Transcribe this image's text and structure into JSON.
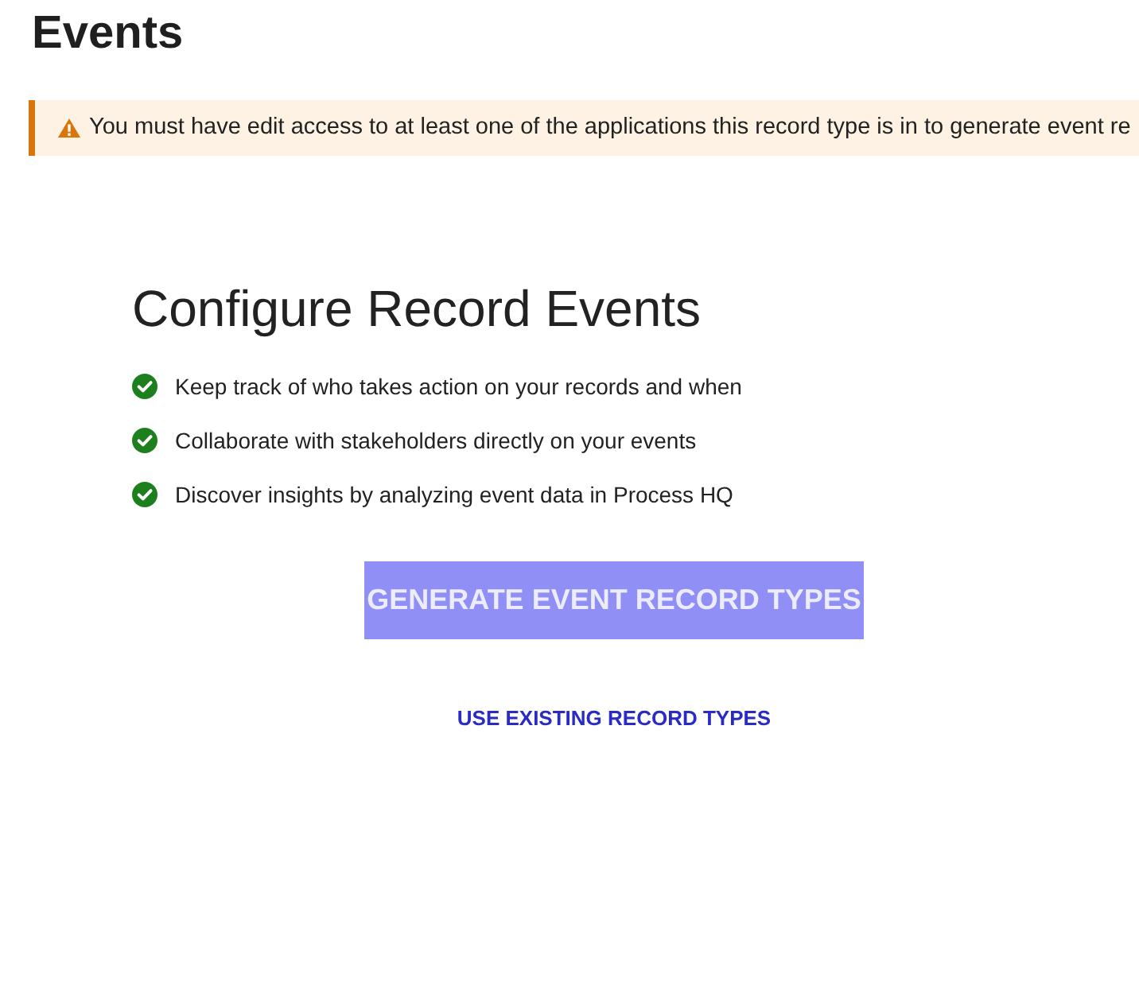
{
  "page": {
    "title": "Events"
  },
  "alert": {
    "kind": "warning",
    "message": "You must have edit access to at least one of the applications this record type is in to generate event re"
  },
  "panel": {
    "heading": "Configure Record Events",
    "features": [
      "Keep track of who takes action on your records and when",
      "Collaborate with stakeholders directly on your events",
      "Discover insights by analyzing event data in Process HQ"
    ],
    "primary_button": {
      "label": "GENERATE EVENT RECORD TYPES",
      "disabled": true
    },
    "link": {
      "label": "USE EXISTING RECORD TYPES"
    }
  }
}
